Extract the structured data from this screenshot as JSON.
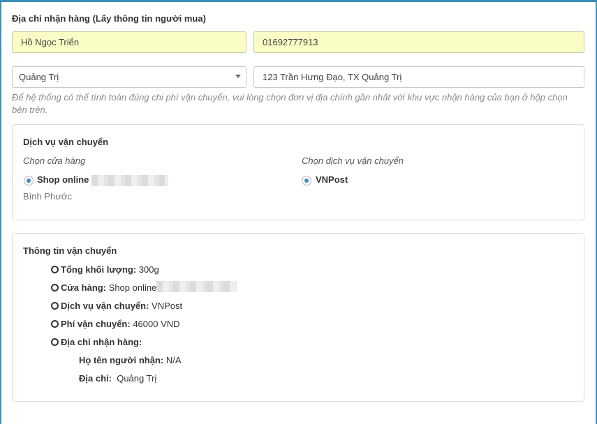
{
  "form": {
    "heading": "Địa chỉ nhận hàng (Lấy thông tin người mua)",
    "name_value": "Hồ Ngọc Triển",
    "phone_value": "01692777913",
    "province_selected": "Quảng Trị",
    "address_value": "123 Trần Hưng Đạo, TX Quảng Trị",
    "hint": "Để hệ thống có thể tính toán đúng chi phí vận chuyển, vui lòng chọn đơn vị địa chính gần nhất với khu vực nhận hàng của bạn ở hộp chọn bên trên."
  },
  "shipping_service": {
    "title": "Dịch vụ vận chuyển",
    "store_label": "Chọn cửa hàng",
    "store_option": "Shop online",
    "store_location": "Bình Phước",
    "carrier_label": "Chọn dịch vụ vận chuyển",
    "carrier_option": "VNPost"
  },
  "shipping_info": {
    "title": "Thông tin vận chuyển",
    "weight_label": "Tổng khối lượng:",
    "weight_value": "300g",
    "store_label": "Cửa hàng:",
    "store_value": "Shop online",
    "service_label": "Dịch vụ vận chuyển:",
    "service_value": "VNPost",
    "fee_label": "Phí vận chuyển:",
    "fee_value": "46000 VND",
    "address_label": "Địa chỉ nhận hàng:",
    "recipient_label": "Họ tên người nhận:",
    "recipient_value": "N/A",
    "addr_label": "Địa chỉ:",
    "addr_value": "Quảng Trị"
  },
  "colors": {
    "accent": "#3c8dbc",
    "filled_input": "#fafcc5"
  }
}
